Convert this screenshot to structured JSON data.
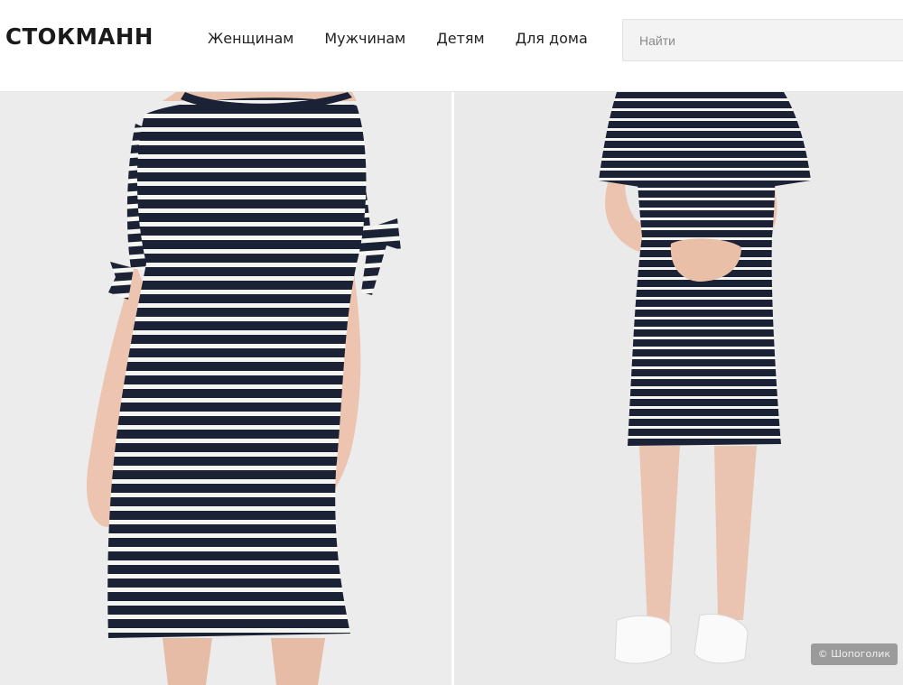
{
  "header": {
    "logo_text": "СТОКМАНН",
    "nav": [
      "Женщинам",
      "Мужчинам",
      "Детям",
      "Для дома"
    ],
    "search_placeholder": "Найти"
  },
  "gallery": {
    "watermark": "© Шопоголик"
  },
  "colors": {
    "stripe_navy": "#1c2235",
    "stripe_white": "#f5f5f2",
    "skin": "#ecc4b0",
    "photo_bg": "#ececec"
  }
}
